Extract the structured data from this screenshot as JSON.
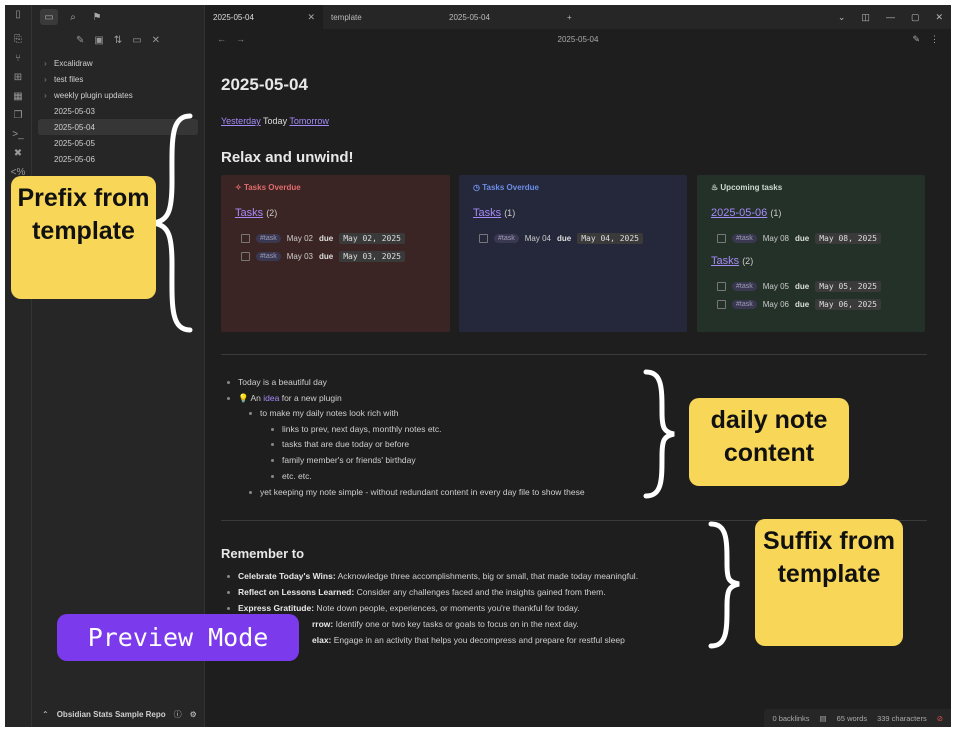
{
  "tabs": [
    {
      "label": "2025-05-04",
      "active": true
    },
    {
      "label": "template",
      "active": false
    },
    {
      "label": "2025-05-04",
      "active": false
    }
  ],
  "nav_title": "2025-05-04",
  "sidebar": {
    "items": [
      {
        "label": "Excalidraw",
        "type": "folder"
      },
      {
        "label": "test files",
        "type": "folder"
      },
      {
        "label": "weekly plugin updates",
        "type": "folder"
      },
      {
        "label": "2025-05-03",
        "type": "file"
      },
      {
        "label": "2025-05-04",
        "type": "file",
        "selected": true
      },
      {
        "label": "2025-05-05",
        "type": "file"
      },
      {
        "label": "2025-05-06",
        "type": "file"
      }
    ],
    "vault_name": "Obsidian Stats Sample Repo"
  },
  "note": {
    "title": "2025-05-04",
    "yesterday": "Yesterday",
    "today": "Today",
    "tomorrow": "Tomorrow",
    "relax_heading": "Relax and unwind!",
    "cards": [
      {
        "header": "Tasks Overdue",
        "sections": [
          {
            "link": "Tasks",
            "count": "(2)",
            "tasks": [
              {
                "tag": "#task",
                "label": "May 02",
                "due": "due",
                "date": "May 02, 2025"
              },
              {
                "tag": "#task",
                "label": "May 03",
                "due": "due",
                "date": "May 03, 2025"
              }
            ]
          }
        ]
      },
      {
        "header": "Tasks Overdue",
        "sections": [
          {
            "link": "Tasks",
            "count": "(1)",
            "tasks": [
              {
                "tag": "#task",
                "label": "May 04",
                "due": "due",
                "date": "May 04, 2025"
              }
            ]
          }
        ]
      },
      {
        "header": "Upcoming tasks",
        "sections": [
          {
            "link": "2025-05-06",
            "count": "(1)",
            "tasks": [
              {
                "tag": "#task",
                "label": "May 08",
                "due": "due",
                "date": "May 08, 2025"
              }
            ]
          },
          {
            "link": "Tasks",
            "count": "(2)",
            "tasks": [
              {
                "tag": "#task",
                "label": "May 05",
                "due": "due",
                "date": "May 05, 2025"
              },
              {
                "tag": "#task",
                "label": "May 06",
                "due": "due",
                "date": "May 06, 2025"
              }
            ]
          }
        ]
      }
    ],
    "bullets": {
      "b1": "Today is a beautiful day",
      "b2_pre": "An ",
      "b2_link": "idea",
      "b2_post": " for a new plugin",
      "b3": "to make my daily notes look rich with",
      "b4": "links to prev, next days, monthly notes etc.",
      "b5": "tasks that are due today or before",
      "b6": "family member's or friends' birthday",
      "b7": "etc. etc.",
      "b8": "yet keeping my note simple - without redundant content in every day file to show these"
    },
    "remember_heading": "Remember to",
    "remember": [
      {
        "bold": "Celebrate Today's Wins:",
        "text": " Acknowledge three accomplishments, big or small, that made today meaningful."
      },
      {
        "bold": "Reflect on Lessons Learned:",
        "text": " Consider any challenges faced and the insights gained from them."
      },
      {
        "bold": "Express Gratitude:",
        "text": " Note down people, experiences, or moments you're thankful for today."
      },
      {
        "bold": "rrow:",
        "text": " Identify one or two key tasks or goals to focus on in the next day."
      },
      {
        "bold": "elax:",
        "text": " Engage in an activity that helps you decompress and prepare for restful sleep"
      }
    ]
  },
  "status": {
    "backlinks": "0 backlinks",
    "words": "65 words",
    "chars": "339 characters"
  },
  "overlays": {
    "prefix": "Prefix from template",
    "daily": "daily note content",
    "suffix": "Suffix from template",
    "preview": "Preview Mode"
  },
  "colors": {
    "accent": "#a68af9",
    "overlay_yellow": "#f7d658",
    "preview_purple": "#7c3aed"
  }
}
